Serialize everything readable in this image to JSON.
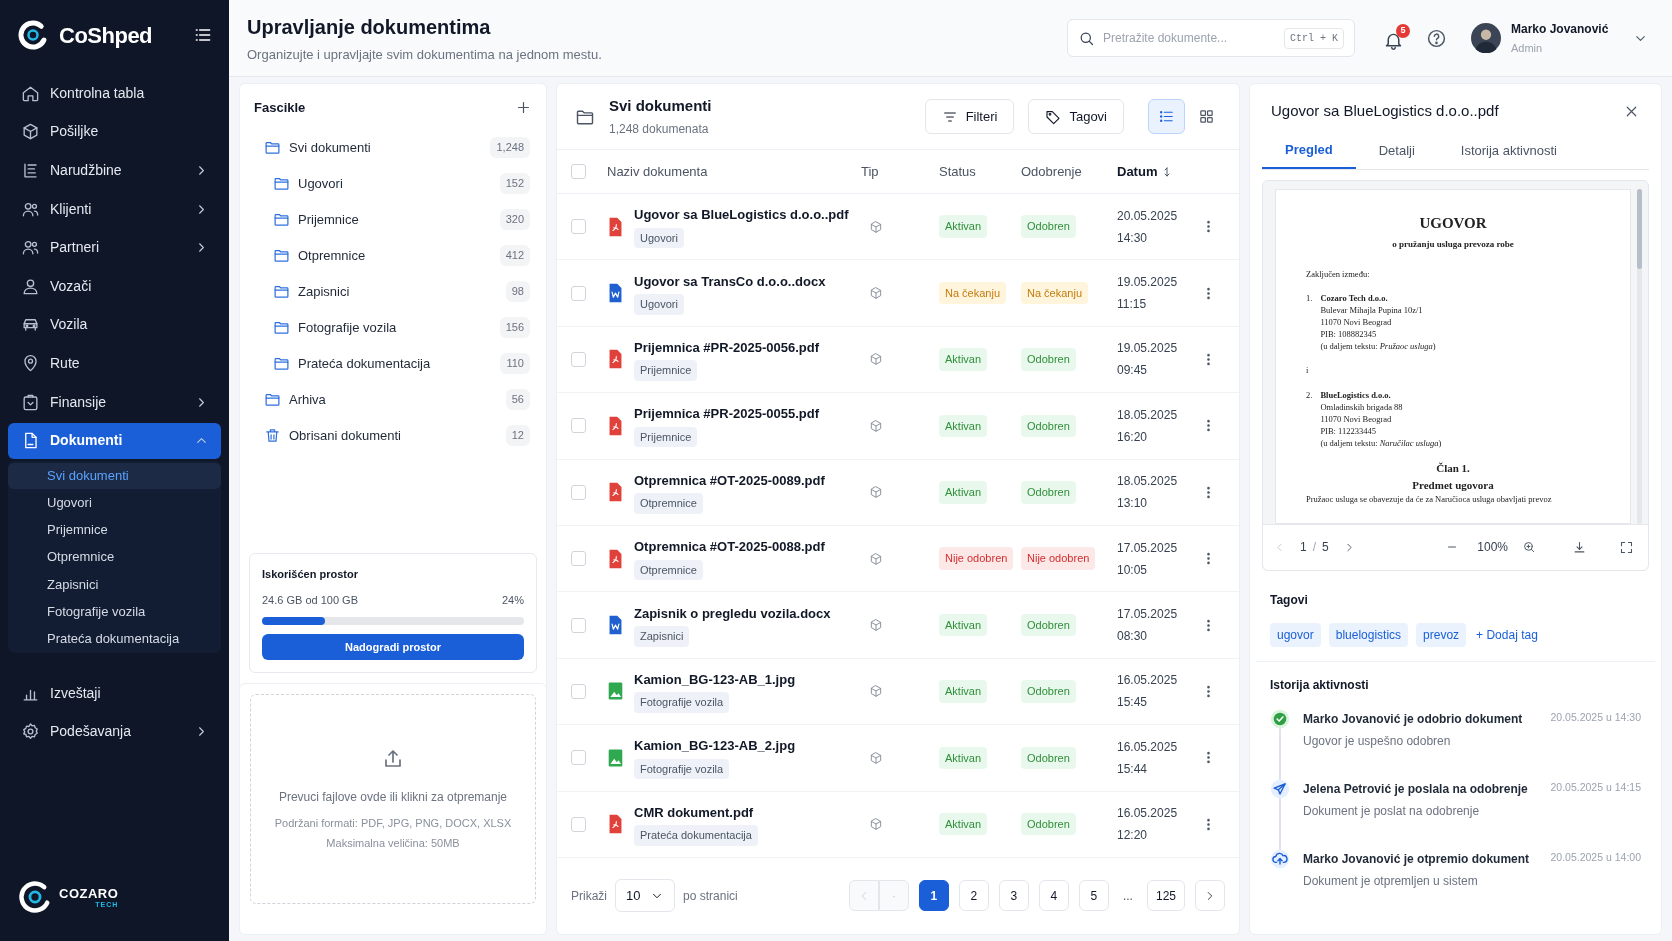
{
  "brand": {
    "name": "CoShped",
    "footer_name": "COZARO",
    "footer_sub": "TECH"
  },
  "sidebar": {
    "items": [
      {
        "label": "Kontrolna tabla",
        "expandable": false,
        "selected": false
      },
      {
        "label": "Pošiljke",
        "expandable": false,
        "selected": false
      },
      {
        "label": "Narudžbine",
        "expandable": true,
        "expanded": false,
        "selected": false
      },
      {
        "label": "Klijenti",
        "expandable": true,
        "expanded": false,
        "selected": false
      },
      {
        "label": "Partneri",
        "expandable": true,
        "expanded": false,
        "selected": false
      },
      {
        "label": "Vozači",
        "expandable": false,
        "selected": false
      },
      {
        "label": "Vozila",
        "expandable": false,
        "selected": false
      },
      {
        "label": "Rute",
        "expandable": false,
        "selected": false
      },
      {
        "label": "Finansije",
        "expandable": true,
        "expanded": false,
        "selected": false
      },
      {
        "label": "Dokumenti",
        "expandable": true,
        "expanded": true,
        "selected": true,
        "children": [
          {
            "label": "Svi dokumenti",
            "selected": true
          },
          {
            "label": "Ugovori",
            "selected": false
          },
          {
            "label": "Prijemnice",
            "selected": false
          },
          {
            "label": "Otpremnice",
            "selected": false
          },
          {
            "label": "Zapisnici",
            "selected": false
          },
          {
            "label": "Fotografije vozila",
            "selected": false
          },
          {
            "label": "Prateća dokumentacija",
            "selected": false
          }
        ]
      },
      {
        "label": "Izveštaji",
        "expandable": false,
        "selected": false
      },
      {
        "label": "Podešavanja",
        "expandable": true,
        "expanded": false,
        "selected": false
      }
    ]
  },
  "header": {
    "title": "Upravljanje dokumentima",
    "subtitle": "Organizujte i upravljajte svim dokumentima na jednom mestu.",
    "search": {
      "placeholder": "Pretražite dokumente...",
      "shortcut": "Ctrl + K"
    },
    "notifications": "5",
    "user": {
      "name": "Marko Jovanović",
      "role": "Admin"
    }
  },
  "folders": {
    "title": "Fascikle",
    "items": [
      {
        "kind": "folder",
        "label": "Svi dokumenti",
        "count": "1,248",
        "children": [
          {
            "kind": "folder",
            "label": "Ugovori",
            "count": "152"
          },
          {
            "kind": "folder",
            "label": "Prijemnice",
            "count": "320"
          },
          {
            "kind": "folder",
            "label": "Otpremnice",
            "count": "412"
          },
          {
            "kind": "folder",
            "label": "Zapisnici",
            "count": "98"
          },
          {
            "kind": "folder",
            "label": "Fotografije vozila",
            "count": "156"
          },
          {
            "kind": "folder",
            "label": "Prateća dokumentacija",
            "count": "110"
          }
        ]
      },
      {
        "kind": "folder",
        "label": "Arhiva",
        "count": "56"
      },
      {
        "kind": "trash",
        "label": "Obrisani dokumenti",
        "count": "12"
      }
    ]
  },
  "storage": {
    "title": "Iskorišćen prostor",
    "used": "24.6 GB od 100 GB",
    "percent": "24%",
    "level": 0.24,
    "button": "Nadogradi prostor"
  },
  "upload": {
    "text": "Prevuci fajlove ovde ili klikni za otpremanje",
    "formats": "Podržani formati: PDF, JPG, PNG, DOCX, XLSX",
    "max": "Maksimalna veličina: 50MB"
  },
  "documents": {
    "title": "Svi dokumenti",
    "count": "1,248 dokumenata",
    "filters": "Filteri",
    "tags": "Tagovi",
    "view": {
      "list_selected": true
    },
    "columns": [
      "Naziv dokumenta",
      "Tip",
      "Status",
      "Odobrenje",
      "Datum"
    ],
    "header_checked": false,
    "rows": [
      {
        "kind": "pdf",
        "name": "Ugovor sa BlueLogistics d.o.o..pdf",
        "folder": "Ugovori",
        "status": {
          "kind": "success",
          "text": "Aktivan"
        },
        "approval": {
          "kind": "success",
          "text": "Odobren"
        },
        "date": "20.05.2025",
        "time": "14:30",
        "checked": false
      },
      {
        "kind": "docx",
        "name": "Ugovor sa TransCo d.o.o..docx",
        "folder": "Ugovori",
        "status": {
          "kind": "warning",
          "text": "Na čekanju"
        },
        "approval": {
          "kind": "warning",
          "text": "Na čekanju"
        },
        "date": "19.05.2025",
        "time": "11:15",
        "checked": false
      },
      {
        "kind": "pdf",
        "name": "Prijemnica #PR-2025-0056.pdf",
        "folder": "Prijemnice",
        "status": {
          "kind": "success",
          "text": "Aktivan"
        },
        "approval": {
          "kind": "success",
          "text": "Odobren"
        },
        "date": "19.05.2025",
        "time": "09:45",
        "checked": false
      },
      {
        "kind": "pdf",
        "name": "Prijemnica #PR-2025-0055.pdf",
        "folder": "Prijemnice",
        "status": {
          "kind": "success",
          "text": "Aktivan"
        },
        "approval": {
          "kind": "success",
          "text": "Odobren"
        },
        "date": "18.05.2025",
        "time": "16:20",
        "checked": false
      },
      {
        "kind": "pdf",
        "name": "Otpremnica #OT-2025-0089.pdf",
        "folder": "Otpremnice",
        "status": {
          "kind": "success",
          "text": "Aktivan"
        },
        "approval": {
          "kind": "success",
          "text": "Odobren"
        },
        "date": "18.05.2025",
        "time": "13:10",
        "checked": false
      },
      {
        "kind": "pdf",
        "name": "Otpremnica #OT-2025-0088.pdf",
        "folder": "Otpremnice",
        "status": {
          "kind": "danger",
          "text": "Nije odobren"
        },
        "approval": {
          "kind": "danger",
          "text": "Nije odobren"
        },
        "date": "17.05.2025",
        "time": "10:05",
        "checked": false
      },
      {
        "kind": "docx",
        "name": "Zapisnik o pregledu vozila.docx",
        "folder": "Zapisnici",
        "status": {
          "kind": "success",
          "text": "Aktivan"
        },
        "approval": {
          "kind": "success",
          "text": "Odobren"
        },
        "date": "17.05.2025",
        "time": "08:30",
        "checked": false
      },
      {
        "kind": "image",
        "name": "Kamion_BG-123-AB_1.jpg",
        "folder": "Fotografije vozila",
        "status": {
          "kind": "success",
          "text": "Aktivan"
        },
        "approval": {
          "kind": "success",
          "text": "Odobren"
        },
        "date": "16.05.2025",
        "time": "15:45",
        "checked": false
      },
      {
        "kind": "image",
        "name": "Kamion_BG-123-AB_2.jpg",
        "folder": "Fotografije vozila",
        "status": {
          "kind": "success",
          "text": "Aktivan"
        },
        "approval": {
          "kind": "success",
          "text": "Odobren"
        },
        "date": "16.05.2025",
        "time": "15:44",
        "checked": false
      },
      {
        "kind": "pdf",
        "name": "CMR dokument.pdf",
        "folder": "Prateća dokumentacija",
        "status": {
          "kind": "success",
          "text": "Aktivan"
        },
        "approval": {
          "kind": "success",
          "text": "Odobren"
        },
        "date": "16.05.2025",
        "time": "12:20",
        "checked": false
      }
    ],
    "footer": {
      "show_label": "Prikaži",
      "page_size": "10",
      "per_page": "po stranici",
      "pages": [
        {
          "kind": "prev",
          "disabled": true
        },
        {
          "kind": "page",
          "label": "·",
          "selected": false,
          "disabled": true
        },
        {
          "kind": "page",
          "label": "1",
          "selected": true,
          "disabled": false
        },
        {
          "kind": "page",
          "label": "2",
          "selected": false,
          "disabled": false
        },
        {
          "kind": "page",
          "label": "3",
          "selected": false,
          "disabled": false
        },
        {
          "kind": "page",
          "label": "4",
          "selected": false,
          "disabled": false
        },
        {
          "kind": "page",
          "label": "5",
          "selected": false,
          "disabled": false
        },
        {
          "kind": "gap",
          "label": "..."
        },
        {
          "kind": "page",
          "label": "125",
          "selected": false,
          "disabled": false
        },
        {
          "kind": "next",
          "disabled": false
        }
      ]
    }
  },
  "detail": {
    "title": "Ugovor sa BlueLogistics d.o.o..pdf",
    "tabs": [
      {
        "label": "Pregled",
        "selected": true
      },
      {
        "label": "Detalji",
        "selected": false
      },
      {
        "label": "Istorija aktivnosti",
        "selected": false
      }
    ],
    "preview": {
      "lines": [
        {
          "kind": "title",
          "text": "UGOVOR"
        },
        {
          "kind": "subtitle",
          "text": "o pružanju usluga prevoza robe"
        },
        {
          "kind": "para",
          "text": "Zaključen između:"
        },
        {
          "kind": "party",
          "number": "1.",
          "name": "Cozaro Tech d.o.o.",
          "lines": [
            "Bulevar Mihajla Pupina 10z/1",
            "11070 Novi Beograd",
            "PIB: 108882345",
            "(u daljem tekstu: *Pružaoc usluga*)"
          ]
        },
        {
          "kind": "para",
          "text": "i"
        },
        {
          "kind": "party",
          "number": "2.",
          "name": "BlueLogistics d.o.o.",
          "lines": [
            "Omladinskih brigada 88",
            "11070 Novi Beograd",
            "PIB: 112233445",
            "(u daljem tekstu: *Naručilac usluga*)"
          ]
        },
        {
          "kind": "heading",
          "text": "Član 1."
        },
        {
          "kind": "heading",
          "text": "Predmet ugovora"
        },
        {
          "kind": "para",
          "text": "Pružaoc usluga se obavezuje da će za Naručioca usluga obavljati prevoz"
        }
      ],
      "page": "1",
      "page_separator": "/",
      "pages": "5",
      "zoom": "100%"
    },
    "tags_title": "Tagovi",
    "tags": [
      "ugovor",
      "bluelogistics",
      "prevoz"
    ],
    "add_tag": "+ Dodaj tag",
    "history_title": "Istorija aktivnosti",
    "history": [
      {
        "kind": "approved",
        "title": "Marko Jovanović je odobrio dokument",
        "text": "Ugovor je uspešno odobren",
        "time": "20.05.2025 u 14:30"
      },
      {
        "kind": "sent",
        "title": "Jelena Petrović je poslala na odobrenje",
        "text": "Dokument je poslat na odobrenje",
        "time": "20.05.2025 u 14:15"
      },
      {
        "kind": "uploaded",
        "title": "Marko Jovanović je otpremio dokument",
        "text": "Dokument je otpremljen u sistem",
        "time": "20.05.2025 u 14:00"
      }
    ]
  }
}
